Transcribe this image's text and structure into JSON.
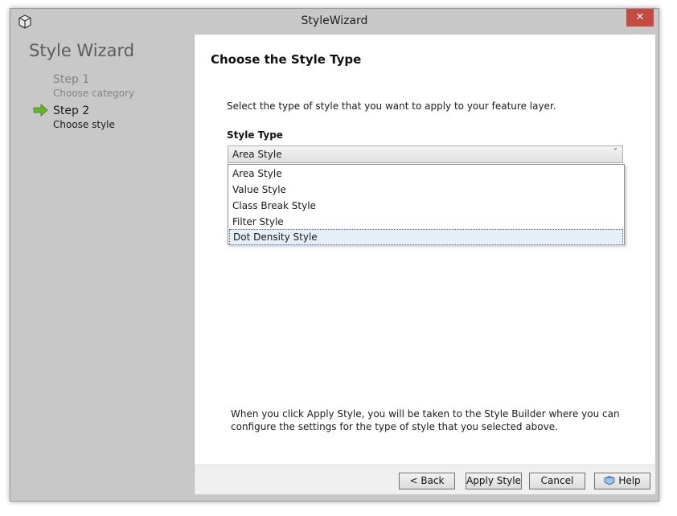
{
  "window": {
    "title": "StyleWizard",
    "close_label": "✕"
  },
  "sidebar": {
    "title": "Style Wizard",
    "steps": [
      {
        "name": "Step 1",
        "desc": "Choose category"
      },
      {
        "name": "Step 2",
        "desc": "Choose style"
      }
    ]
  },
  "main": {
    "heading": "Choose the Style Type",
    "instructions": "Select the type of style that you want to apply to your feature layer.",
    "style_type_label": "Style Type",
    "combo_value": "Area Style",
    "options": [
      "Area Style",
      "Value Style",
      "Class Break Style",
      "Filter Style",
      "Dot Density Style"
    ],
    "footer_text": "When you click Apply Style, you will be taken to the Style Builder where you can configure the settings for the type of style that you selected above."
  },
  "buttons": {
    "back": "< Back",
    "apply": "Apply Style",
    "cancel": "Cancel",
    "help": "Help"
  },
  "colors": {
    "close": "#c74a40",
    "arrow": "#6ab42c",
    "selection": "#e6eef8"
  }
}
